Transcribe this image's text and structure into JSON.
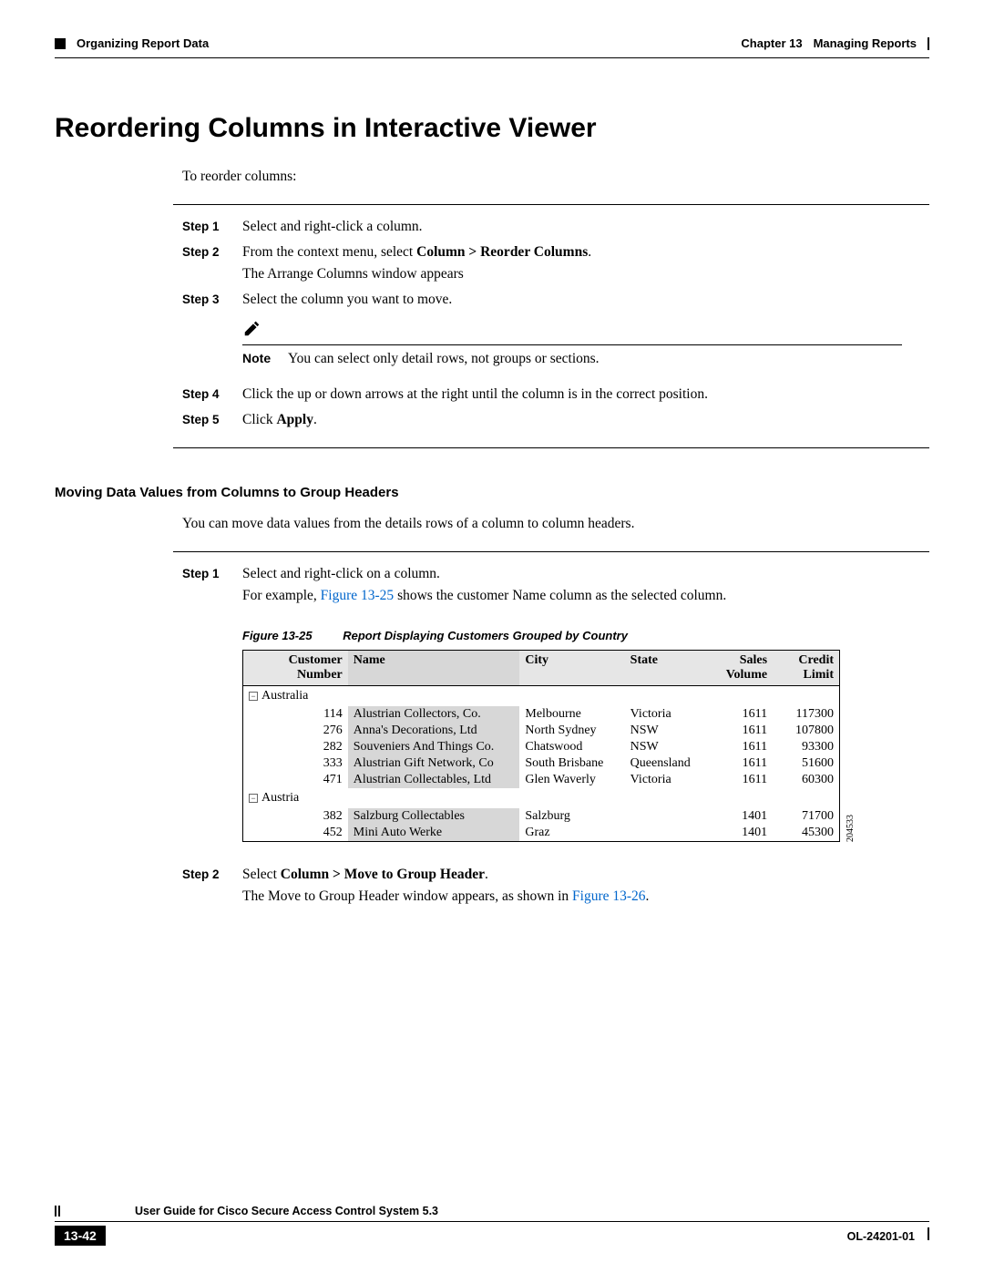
{
  "header": {
    "section": "Organizing Report Data",
    "chapter": "Chapter 13",
    "chapter_title": "Managing Reports"
  },
  "heading": "Reordering Columns in Interactive Viewer",
  "intro": "To reorder columns:",
  "steps_a": [
    {
      "label": "Step 1",
      "text": "Select and right-click a column."
    },
    {
      "label": "Step 2",
      "text_prefix": "From the context menu, select ",
      "bold": "Column > Reorder Columns",
      "text_suffix": ".",
      "extra": "The Arrange Columns window appears"
    },
    {
      "label": "Step 3",
      "text": "Select the column you want to move."
    }
  ],
  "note": {
    "label": "Note",
    "text": "You can select only detail rows, not groups or sections."
  },
  "steps_b": [
    {
      "label": "Step 4",
      "text": "Click the up or down arrows at the right until the column is in the correct position."
    },
    {
      "label": "Step 5",
      "text_prefix": "Click ",
      "bold": "Apply",
      "text_suffix": "."
    }
  ],
  "subheading": "Moving Data Values from Columns to Group Headers",
  "subintro": "You can move data values from the details rows of a column to column headers.",
  "steps_c": {
    "s1": {
      "label": "Step 1",
      "line1": "Select and right-click on a column.",
      "line2_prefix": "For example, ",
      "line2_link": "Figure 13-25",
      "line2_suffix": " shows the customer Name column as the selected column."
    },
    "s2": {
      "label": "Step 2",
      "line1_prefix": "Select ",
      "line1_bold": "Column > Move to Group Header",
      "line1_suffix": ".",
      "line2_prefix": "The Move to Group Header window appears, as shown in ",
      "line2_link": "Figure 13-26",
      "line2_suffix": "."
    }
  },
  "figure": {
    "label": "Figure 13-25",
    "title": "Report Displaying Customers Grouped by Country",
    "side_code": "204533"
  },
  "table": {
    "headers": [
      "Customer Number",
      "Name",
      "City",
      "State",
      "Sales Volume",
      "Credit Limit"
    ],
    "groups": [
      {
        "name": "Australia",
        "rows": [
          {
            "num": "114",
            "name": "Alustrian Collectors, Co.",
            "city": "Melbourne",
            "state": "Victoria",
            "sales": "1611",
            "credit": "117300"
          },
          {
            "num": "276",
            "name": "Anna's Decorations, Ltd",
            "city": "North Sydney",
            "state": "NSW",
            "sales": "1611",
            "credit": "107800"
          },
          {
            "num": "282",
            "name": "Souveniers And Things Co.",
            "city": "Chatswood",
            "state": "NSW",
            "sales": "1611",
            "credit": "93300"
          },
          {
            "num": "333",
            "name": "Alustrian Gift Network, Co",
            "city": "South Brisbane",
            "state": "Queensland",
            "sales": "1611",
            "credit": "51600"
          },
          {
            "num": "471",
            "name": "Alustrian Collectables, Ltd",
            "city": "Glen Waverly",
            "state": "Victoria",
            "sales": "1611",
            "credit": "60300"
          }
        ]
      },
      {
        "name": "Austria",
        "rows": [
          {
            "num": "382",
            "name": "Salzburg Collectables",
            "city": "Salzburg",
            "state": "",
            "sales": "1401",
            "credit": "71700"
          },
          {
            "num": "452",
            "name": "Mini Auto Werke",
            "city": "Graz",
            "state": "",
            "sales": "1401",
            "credit": "45300"
          }
        ]
      }
    ]
  },
  "footer": {
    "guide": "User Guide for Cisco Secure Access Control System 5.3",
    "page": "13-42",
    "docid": "OL-24201-01"
  }
}
